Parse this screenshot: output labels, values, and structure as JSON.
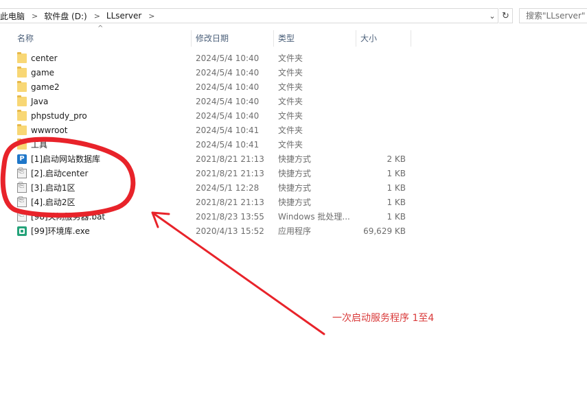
{
  "address": {
    "crumbs": [
      "此电脑",
      "软件盘 (D:)",
      "LLserver"
    ],
    "search_placeholder": "搜索\"LLserver\""
  },
  "columns": {
    "name": "名称",
    "date": "修改日期",
    "type": "类型",
    "size": "大小"
  },
  "files": [
    {
      "name": "center",
      "date": "2024/5/4 10:40",
      "type": "文件夹",
      "size": "",
      "icon": "folder-icon"
    },
    {
      "name": "game",
      "date": "2024/5/4 10:40",
      "type": "文件夹",
      "size": "",
      "icon": "folder-icon"
    },
    {
      "name": "game2",
      "date": "2024/5/4 10:40",
      "type": "文件夹",
      "size": "",
      "icon": "folder-icon"
    },
    {
      "name": "Java",
      "date": "2024/5/4 10:40",
      "type": "文件夹",
      "size": "",
      "icon": "folder-icon"
    },
    {
      "name": "phpstudy_pro",
      "date": "2024/5/4 10:40",
      "type": "文件夹",
      "size": "",
      "icon": "folder-icon"
    },
    {
      "name": "wwwroot",
      "date": "2024/5/4 10:41",
      "type": "文件夹",
      "size": "",
      "icon": "folder-icon"
    },
    {
      "name": "工具",
      "date": "2024/5/4 10:41",
      "type": "文件夹",
      "size": "",
      "icon": "folder-icon"
    },
    {
      "name": "[1]启动网站数据库",
      "date": "2021/8/21 21:13",
      "type": "快捷方式",
      "size": "2 KB",
      "icon": "phpstudy-shortcut-icon"
    },
    {
      "name": "[2].启动center",
      "date": "2021/8/21 21:13",
      "type": "快捷方式",
      "size": "1 KB",
      "icon": "shortcut-icon"
    },
    {
      "name": "[3].启动1区",
      "date": "2024/5/1 12:28",
      "type": "快捷方式",
      "size": "1 KB",
      "icon": "shortcut-icon"
    },
    {
      "name": "[4].启动2区",
      "date": "2021/8/21 21:13",
      "type": "快捷方式",
      "size": "1 KB",
      "icon": "shortcut-icon"
    },
    {
      "name": "[98]关闭服务器.bat",
      "date": "2021/8/23 13:55",
      "type": "Windows 批处理...",
      "size": "1 KB",
      "icon": "batch-file-icon"
    },
    {
      "name": "[99]环境库.exe",
      "date": "2020/4/13 15:52",
      "type": "应用程序",
      "size": "69,629 KB",
      "icon": "vs-installer-icon"
    }
  ],
  "annotation": {
    "text": "一次启动服务程序 1至4",
    "color": "#d93a3a"
  }
}
